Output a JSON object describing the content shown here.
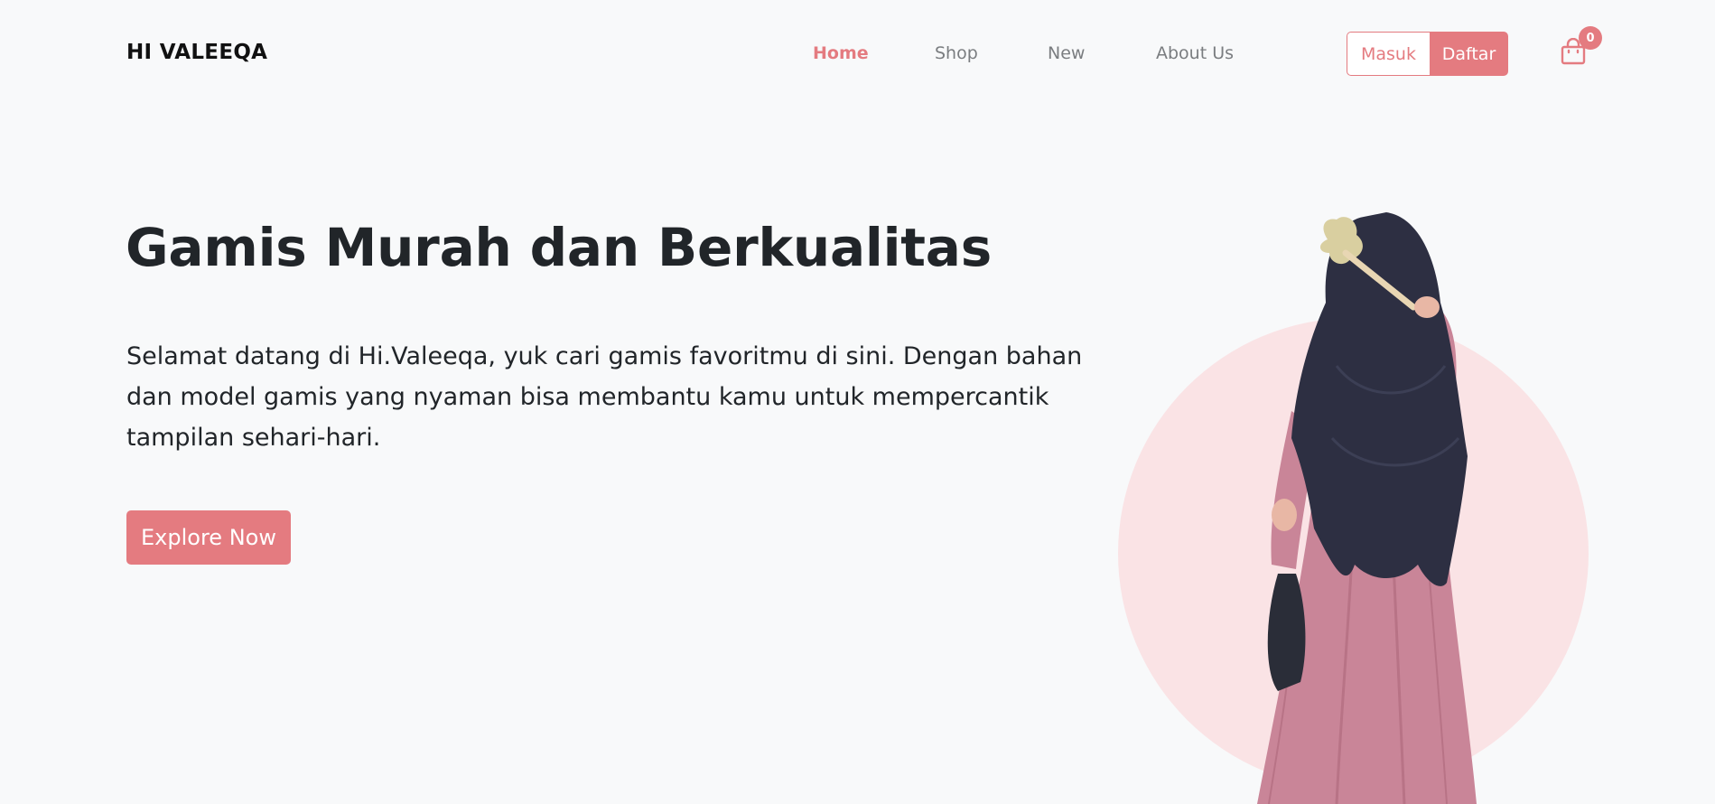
{
  "navbar": {
    "brand": "HI VALEEQA",
    "links": [
      {
        "label": "Home",
        "active": true
      },
      {
        "label": "Shop",
        "active": false
      },
      {
        "label": "New",
        "active": false
      },
      {
        "label": "About Us",
        "active": false
      }
    ],
    "login_label": "Masuk",
    "register_label": "Daftar",
    "cart": {
      "icon": "shopping-bag-icon",
      "count": "0"
    }
  },
  "hero": {
    "title": "Gamis Murah dan Berkualitas",
    "description": "Selamat datang di Hi.Valeeqa, yuk cari gamis favoritmu di sini. Dengan bahan dan model gamis yang nyaman bisa membantu kamu untuk mempercantik tampilan sehari-hari.",
    "cta_label": "Explore Now"
  },
  "colors": {
    "accent": "#e47b80",
    "background": "#f8f9fa",
    "circle": "#fae3e5",
    "text": "#212529",
    "nav_text": "#7a7d80"
  }
}
